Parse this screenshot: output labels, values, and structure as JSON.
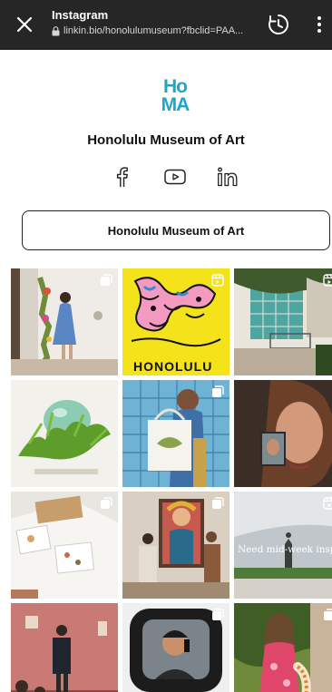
{
  "browser": {
    "title": "Instagram",
    "url": "linkin.bio/honolulumuseum?fbclid=PAA..."
  },
  "profile": {
    "logo_line1": "Ho",
    "logo_line2": "MA",
    "name": "Honolulu Museum of Art",
    "socials": [
      "facebook-icon",
      "youtube-icon",
      "linkedin-icon"
    ],
    "link_button_label": "Honolulu Museum of Art"
  },
  "colors": {
    "topbar": "#262626",
    "logo": "#1aa7c9",
    "poster_yellow": "#f4e21a"
  },
  "grid": {
    "tiles": [
      {
        "badge": "carousel-icon"
      },
      {
        "badge": "reel-icon",
        "text": "HONOLULU"
      },
      {
        "badge": "reel-icon"
      },
      {
        "badge": "none"
      },
      {
        "badge": "carousel-icon"
      },
      {
        "badge": "none"
      },
      {
        "badge": "carousel-icon"
      },
      {
        "badge": "carousel-icon"
      },
      {
        "badge": "reel-icon",
        "caption": "Need mid-week inspo"
      },
      {
        "badge": "none"
      },
      {
        "badge": "carousel-icon"
      },
      {
        "badge": "carousel-icon"
      }
    ]
  }
}
